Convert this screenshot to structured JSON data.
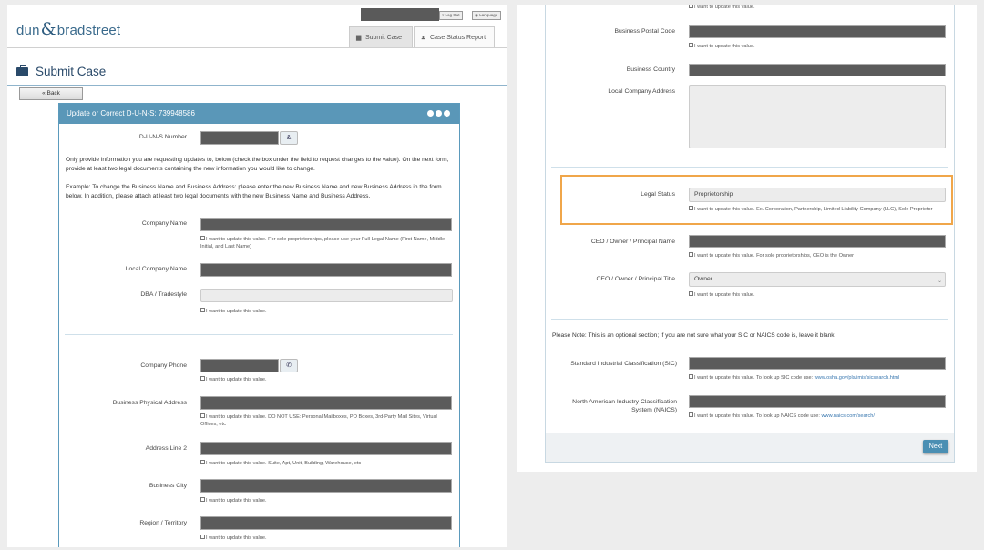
{
  "left": {
    "logo": {
      "part1": "dun",
      "amp": "&",
      "part2": "bradstreet"
    },
    "header": {
      "logout": "Log Out",
      "language": "Language"
    },
    "tabs": [
      {
        "label": "Submit Case",
        "icon": "briefcase-icon"
      },
      {
        "label": "Case Status Report",
        "icon": "hourglass-icon"
      }
    ],
    "page_title": "Submit Case",
    "back_label": "« Back",
    "panel_title": "Update or Correct D-U-N-S: 739948586",
    "duns_label": "D-U-N-S Number",
    "intro_1": "Only provide information you are requesting updates to, below (check the box under the field to request changes to the value). On the next form, provide at least two legal documents containing the new information you would like to change.",
    "intro_2": "Example: To change the Business Name and Business Address: please enter the new Business Name and new Business Address in the form below.  In addition, please attach at least two legal documents  with the new Business Name and Business Address.",
    "fields": {
      "company_name": {
        "label": "Company Name",
        "hint": "I want to update this value. For sole proprietorships, please use your Full Legal Name (First Name, Middle Initial, and Last Name)"
      },
      "local_company_name": {
        "label": "Local Company Name"
      },
      "dba": {
        "label": "DBA / Tradestyle",
        "hint": "I want to update this value."
      },
      "company_phone": {
        "label": "Company Phone",
        "hint": "I want to update this value."
      },
      "physical_address": {
        "label": "Business Physical Address",
        "hint": "I want to update this value. DO NOT USE: Personal Mailboxes, PO Boxes, 3rd-Party Mail Sites, Virtual Offices, etc"
      },
      "address_line_2": {
        "label": "Address Line 2",
        "hint": "I want to update this value. Suite, Apt, Unit, Building, Warehouse, etc"
      },
      "city": {
        "label": "Business City",
        "hint": "I want to update this value."
      },
      "region": {
        "label": "Region / Territory",
        "hint": "I want to update this value."
      }
    }
  },
  "right": {
    "top_hint": "I want to update this value.",
    "postal_code": {
      "label": "Business Postal Code",
      "hint": "I want to update this value."
    },
    "country": {
      "label": "Business Country"
    },
    "local_address": {
      "label": "Local Company Address"
    },
    "legal_status": {
      "label": "Legal Status",
      "value": "Proprietorship",
      "hint": "I want to update this value. Ex. Corporation, Partnership, Limited Liability Company (LLC), Sole Proprietor"
    },
    "ceo_name": {
      "label": "CEO / Owner / Principal Name",
      "hint": "I want to update this value. For sole proprietorships, CEO is the Owner"
    },
    "ceo_title": {
      "label": "CEO / Owner / Principal Title",
      "value": "Owner",
      "hint": "I want to update this value."
    },
    "note": "Please Note: This is an optional section; if you are not sure what your SIC or NAICS code is, leave it blank.",
    "sic": {
      "label": "Standard Industrial Classification (SIC)",
      "hint": "I want to update this value. To look up SIC code use: ",
      "link": "www.osha.gov/pls/imis/sicsearch.html"
    },
    "naics": {
      "label_1": "North American Industry Classification",
      "label_2": "System (NAICS)",
      "hint": "I want to update this value. To look up NAICS code use: ",
      "link": "www.naics.com/search/"
    },
    "next_label": "Next"
  },
  "colors": {
    "accent": "#5a97b8",
    "highlight": "#f0a64a",
    "redacted": "#5b5b5b"
  }
}
